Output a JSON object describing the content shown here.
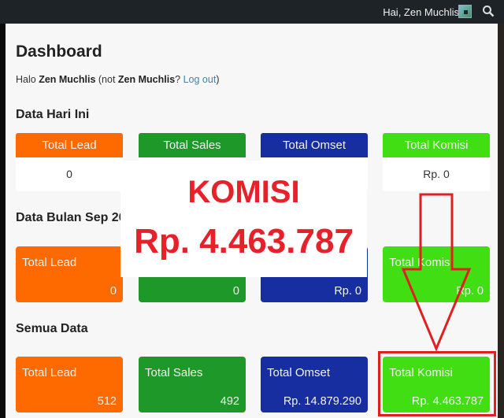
{
  "topbar": {
    "greeting": "Hai, Zen Muchlis",
    "icons": [
      "avatar",
      "search-icon"
    ]
  },
  "page": {
    "title": "Dashboard",
    "hello": {
      "prefix": "Halo ",
      "name": "Zen Muchlis",
      "mid": " (not ",
      "name2": "Zen Muchlis",
      "q": "? ",
      "logout": "Log out",
      "suffix": ")"
    }
  },
  "sections": {
    "today": {
      "title": "Data Hari Ini",
      "cards": [
        {
          "label": "Total Lead",
          "value": "0"
        },
        {
          "label": "Total Sales",
          "value": ""
        },
        {
          "label": "Total Omset",
          "value": ""
        },
        {
          "label": "Total Komisi",
          "value": "Rp. 0"
        }
      ]
    },
    "month": {
      "title": "Data Bulan Sep 20",
      "cards": [
        {
          "label": "Total Lead",
          "value": "0"
        },
        {
          "label": "",
          "value": "0"
        },
        {
          "label": "",
          "value": "Rp. 0"
        },
        {
          "label": "Total Komisi",
          "value": "Rp. 0"
        }
      ]
    },
    "all": {
      "title": "Semua Data",
      "cards": [
        {
          "label": "Total Lead",
          "value": "512"
        },
        {
          "label": "Total Sales",
          "value": "492"
        },
        {
          "label": "Total Omset",
          "value": "Rp. 14.879.290"
        },
        {
          "label": "Total Komisi",
          "value": "Rp. 4.463.787"
        }
      ]
    }
  },
  "overlay": {
    "line1": "KOMISI",
    "line2": "Rp. 4.463.787"
  },
  "colors": {
    "lead": "#ff6a00",
    "sales": "#1e9829",
    "omset": "#172ea0",
    "komisi": "#42de14",
    "annotation": "#e02020"
  }
}
